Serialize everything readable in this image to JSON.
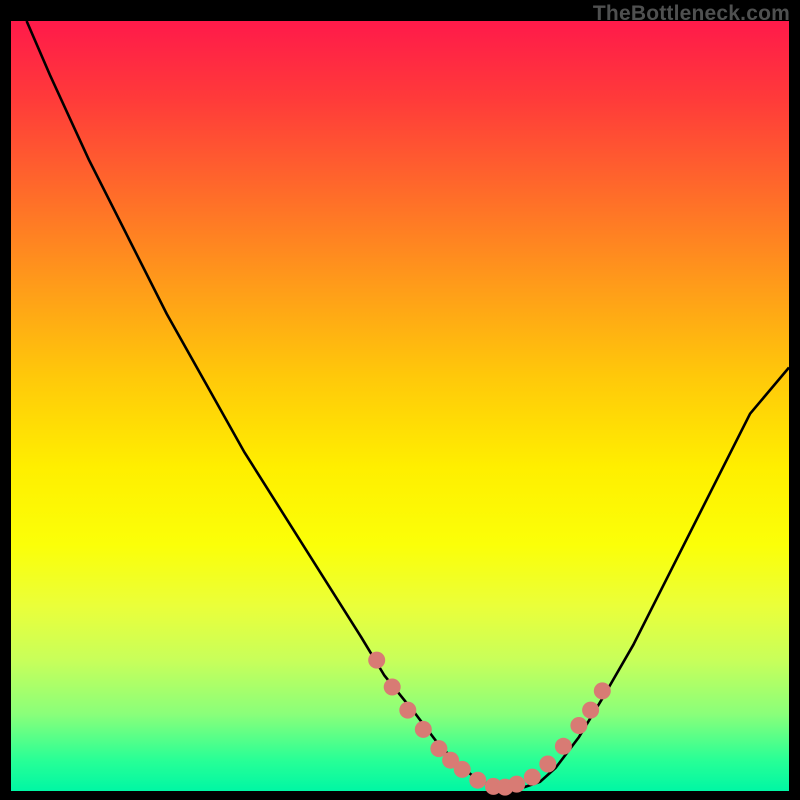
{
  "watermark": "TheBottleneck.com",
  "chart_data": {
    "type": "line",
    "title": "",
    "xlabel": "",
    "ylabel": "",
    "xlim": [
      0,
      100
    ],
    "ylim": [
      0,
      100
    ],
    "curve": {
      "description": "V-shaped bottleneck curve; bottleneck percentage (y) vs component balance (x). Minimum ≈0% near x≈60.",
      "x": [
        2,
        5,
        10,
        15,
        20,
        25,
        30,
        35,
        40,
        45,
        48,
        52,
        55,
        58,
        60,
        62,
        64,
        66,
        68,
        70,
        73,
        76,
        80,
        85,
        90,
        95,
        100
      ],
      "y": [
        100,
        93,
        82,
        72,
        62,
        53,
        44,
        36,
        28,
        20,
        15,
        10,
        6,
        3,
        1.5,
        0.6,
        0.3,
        0.5,
        1.2,
        3,
        7,
        12,
        19,
        29,
        39,
        49,
        55
      ]
    },
    "markers": {
      "description": "Salmon markers near the valley region",
      "x": [
        47,
        49,
        51,
        53,
        55,
        56.5,
        58,
        60,
        62,
        63.5,
        65,
        67,
        69,
        71,
        73,
        74.5,
        76
      ],
      "y": [
        17,
        13.5,
        10.5,
        8,
        5.5,
        4,
        2.8,
        1.4,
        0.6,
        0.5,
        0.9,
        1.8,
        3.5,
        5.8,
        8.5,
        10.5,
        13
      ]
    },
    "colors": {
      "gradient_top": "#ff1a4a",
      "gradient_mid": "#ffef00",
      "gradient_bottom": "#00f7a4",
      "curve": "#000000",
      "markers": "#d87b74"
    }
  }
}
